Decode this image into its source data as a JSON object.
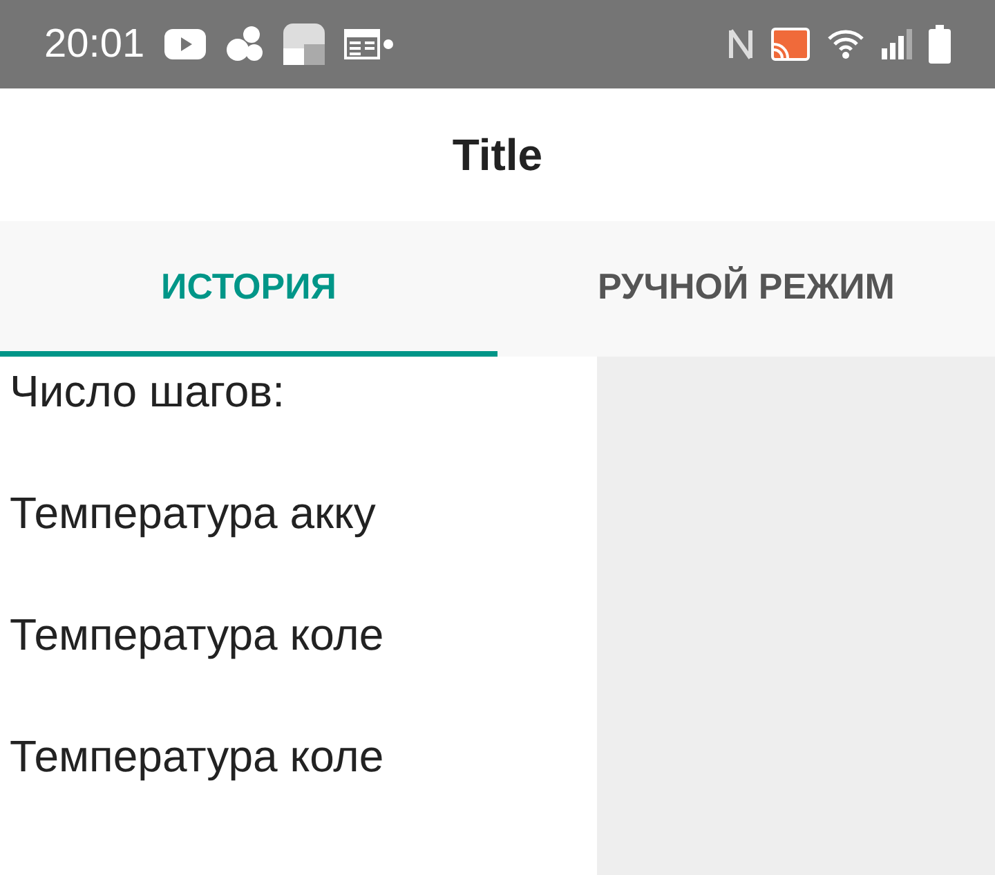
{
  "status_bar": {
    "time": "20:01"
  },
  "app_bar": {
    "title": "Title"
  },
  "tabs": [
    {
      "label": "ИСТОРИЯ",
      "selected": true
    },
    {
      "label": "РУЧНОЙ РЕЖИМ",
      "selected": false
    }
  ],
  "fields": [
    {
      "label": "Число шагов:"
    },
    {
      "label": "Температура акку"
    },
    {
      "label": "Температура коле"
    },
    {
      "label": "Температура коле"
    }
  ]
}
